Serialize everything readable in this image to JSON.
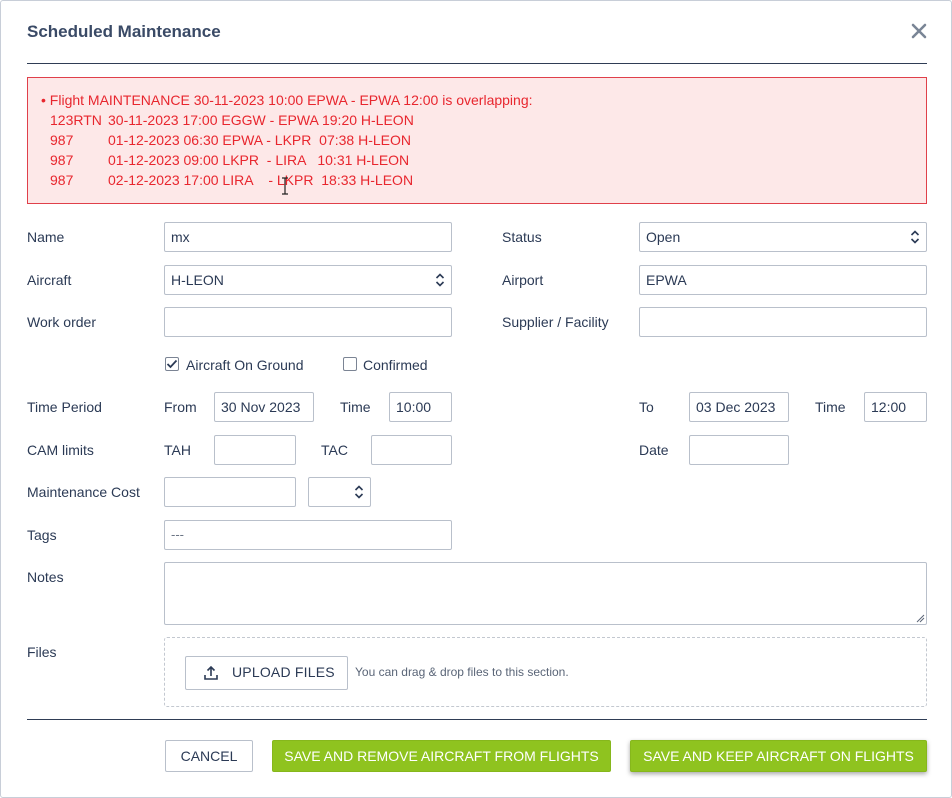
{
  "dialog": {
    "title": "Scheduled Maintenance",
    "close_icon": "close-icon"
  },
  "alert": {
    "header": "Flight MAINTENANCE 30-11-2023 10:00 EPWA - EPWA 12:00 is overlapping:",
    "bullet": "•",
    "rows": [
      {
        "flight": "123RTN",
        "details": "30-11-2023 17:00 EGGW - EPWA 19:20 H-LEON"
      },
      {
        "flight": "987",
        "details": "01-12-2023 06:30 EPWA - LKPR  07:38 H-LEON"
      },
      {
        "flight": "987",
        "details": "01-12-2023 09:00 LKPR  - LIRA   10:31 H-LEON"
      },
      {
        "flight": "987",
        "details": "02-12-2023 17:00 LIRA    - LKPR  18:33 H-LEON"
      }
    ],
    "color": "#e8262e"
  },
  "form": {
    "name": {
      "label": "Name",
      "value": "mx"
    },
    "status": {
      "label": "Status",
      "value": "Open"
    },
    "aircraft": {
      "label": "Aircraft",
      "value": "H-LEON"
    },
    "airport": {
      "label": "Airport",
      "value": "EPWA"
    },
    "work_order": {
      "label": "Work order",
      "value": ""
    },
    "supplier": {
      "label": "Supplier / Facility",
      "value": ""
    },
    "aog": {
      "label": "Aircraft On Ground",
      "checked": true
    },
    "confirmed": {
      "label": "Confirmed",
      "checked": false
    },
    "time_period": {
      "label": "Time Period",
      "from_label": "From",
      "from_value": "30 Nov 2023",
      "time_label": "Time",
      "time_value": "10:00",
      "to_label": "To",
      "to_value": "03 Dec 2023",
      "to_time_label": "Time",
      "to_time_value": "12:00"
    },
    "cam_limits": {
      "label": "CAM limits",
      "tah_label": "TAH",
      "tah_value": "",
      "tac_label": "TAC",
      "tac_value": "",
      "date_label": "Date",
      "date_value": ""
    },
    "maintenance_cost": {
      "label": "Maintenance Cost",
      "value": "",
      "currency": ""
    },
    "tags": {
      "label": "Tags",
      "placeholder": "---"
    },
    "notes": {
      "label": "Notes",
      "value": ""
    },
    "files": {
      "label": "Files",
      "upload_label": "UPLOAD FILES",
      "hint": "You can drag & drop files to this section."
    }
  },
  "actions": {
    "cancel": "CANCEL",
    "save_remove": "SAVE AND REMOVE AIRCRAFT FROM FLIGHTS",
    "save_keep": "SAVE AND KEEP AIRCRAFT ON FLIGHTS",
    "accent": "#8fc31f"
  }
}
